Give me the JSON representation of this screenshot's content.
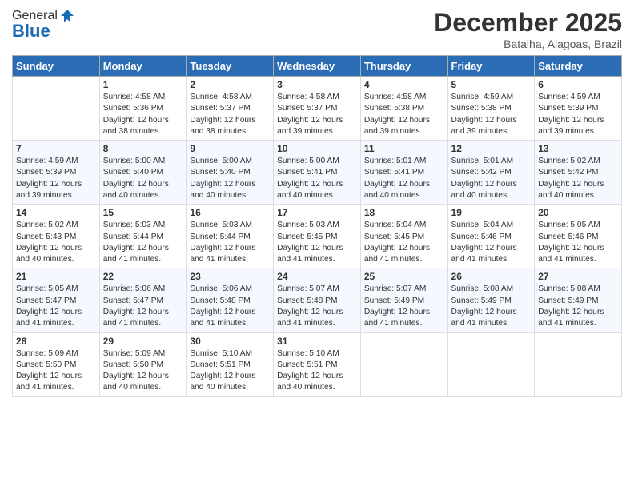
{
  "logo": {
    "general": "General",
    "blue": "Blue"
  },
  "header": {
    "month": "December 2025",
    "location": "Batalha, Alagoas, Brazil"
  },
  "weekdays": [
    "Sunday",
    "Monday",
    "Tuesday",
    "Wednesday",
    "Thursday",
    "Friday",
    "Saturday"
  ],
  "weeks": [
    [
      {
        "day": "",
        "detail": ""
      },
      {
        "day": "1",
        "detail": "Sunrise: 4:58 AM\nSunset: 5:36 PM\nDaylight: 12 hours\nand 38 minutes."
      },
      {
        "day": "2",
        "detail": "Sunrise: 4:58 AM\nSunset: 5:37 PM\nDaylight: 12 hours\nand 38 minutes."
      },
      {
        "day": "3",
        "detail": "Sunrise: 4:58 AM\nSunset: 5:37 PM\nDaylight: 12 hours\nand 39 minutes."
      },
      {
        "day": "4",
        "detail": "Sunrise: 4:58 AM\nSunset: 5:38 PM\nDaylight: 12 hours\nand 39 minutes."
      },
      {
        "day": "5",
        "detail": "Sunrise: 4:59 AM\nSunset: 5:38 PM\nDaylight: 12 hours\nand 39 minutes."
      },
      {
        "day": "6",
        "detail": "Sunrise: 4:59 AM\nSunset: 5:39 PM\nDaylight: 12 hours\nand 39 minutes."
      }
    ],
    [
      {
        "day": "7",
        "detail": "Sunrise: 4:59 AM\nSunset: 5:39 PM\nDaylight: 12 hours\nand 39 minutes."
      },
      {
        "day": "8",
        "detail": "Sunrise: 5:00 AM\nSunset: 5:40 PM\nDaylight: 12 hours\nand 40 minutes."
      },
      {
        "day": "9",
        "detail": "Sunrise: 5:00 AM\nSunset: 5:40 PM\nDaylight: 12 hours\nand 40 minutes."
      },
      {
        "day": "10",
        "detail": "Sunrise: 5:00 AM\nSunset: 5:41 PM\nDaylight: 12 hours\nand 40 minutes."
      },
      {
        "day": "11",
        "detail": "Sunrise: 5:01 AM\nSunset: 5:41 PM\nDaylight: 12 hours\nand 40 minutes."
      },
      {
        "day": "12",
        "detail": "Sunrise: 5:01 AM\nSunset: 5:42 PM\nDaylight: 12 hours\nand 40 minutes."
      },
      {
        "day": "13",
        "detail": "Sunrise: 5:02 AM\nSunset: 5:42 PM\nDaylight: 12 hours\nand 40 minutes."
      }
    ],
    [
      {
        "day": "14",
        "detail": "Sunrise: 5:02 AM\nSunset: 5:43 PM\nDaylight: 12 hours\nand 40 minutes."
      },
      {
        "day": "15",
        "detail": "Sunrise: 5:03 AM\nSunset: 5:44 PM\nDaylight: 12 hours\nand 41 minutes."
      },
      {
        "day": "16",
        "detail": "Sunrise: 5:03 AM\nSunset: 5:44 PM\nDaylight: 12 hours\nand 41 minutes."
      },
      {
        "day": "17",
        "detail": "Sunrise: 5:03 AM\nSunset: 5:45 PM\nDaylight: 12 hours\nand 41 minutes."
      },
      {
        "day": "18",
        "detail": "Sunrise: 5:04 AM\nSunset: 5:45 PM\nDaylight: 12 hours\nand 41 minutes."
      },
      {
        "day": "19",
        "detail": "Sunrise: 5:04 AM\nSunset: 5:46 PM\nDaylight: 12 hours\nand 41 minutes."
      },
      {
        "day": "20",
        "detail": "Sunrise: 5:05 AM\nSunset: 5:46 PM\nDaylight: 12 hours\nand 41 minutes."
      }
    ],
    [
      {
        "day": "21",
        "detail": "Sunrise: 5:05 AM\nSunset: 5:47 PM\nDaylight: 12 hours\nand 41 minutes."
      },
      {
        "day": "22",
        "detail": "Sunrise: 5:06 AM\nSunset: 5:47 PM\nDaylight: 12 hours\nand 41 minutes."
      },
      {
        "day": "23",
        "detail": "Sunrise: 5:06 AM\nSunset: 5:48 PM\nDaylight: 12 hours\nand 41 minutes."
      },
      {
        "day": "24",
        "detail": "Sunrise: 5:07 AM\nSunset: 5:48 PM\nDaylight: 12 hours\nand 41 minutes."
      },
      {
        "day": "25",
        "detail": "Sunrise: 5:07 AM\nSunset: 5:49 PM\nDaylight: 12 hours\nand 41 minutes."
      },
      {
        "day": "26",
        "detail": "Sunrise: 5:08 AM\nSunset: 5:49 PM\nDaylight: 12 hours\nand 41 minutes."
      },
      {
        "day": "27",
        "detail": "Sunrise: 5:08 AM\nSunset: 5:49 PM\nDaylight: 12 hours\nand 41 minutes."
      }
    ],
    [
      {
        "day": "28",
        "detail": "Sunrise: 5:09 AM\nSunset: 5:50 PM\nDaylight: 12 hours\nand 41 minutes."
      },
      {
        "day": "29",
        "detail": "Sunrise: 5:09 AM\nSunset: 5:50 PM\nDaylight: 12 hours\nand 40 minutes."
      },
      {
        "day": "30",
        "detail": "Sunrise: 5:10 AM\nSunset: 5:51 PM\nDaylight: 12 hours\nand 40 minutes."
      },
      {
        "day": "31",
        "detail": "Sunrise: 5:10 AM\nSunset: 5:51 PM\nDaylight: 12 hours\nand 40 minutes."
      },
      {
        "day": "",
        "detail": ""
      },
      {
        "day": "",
        "detail": ""
      },
      {
        "day": "",
        "detail": ""
      }
    ]
  ]
}
